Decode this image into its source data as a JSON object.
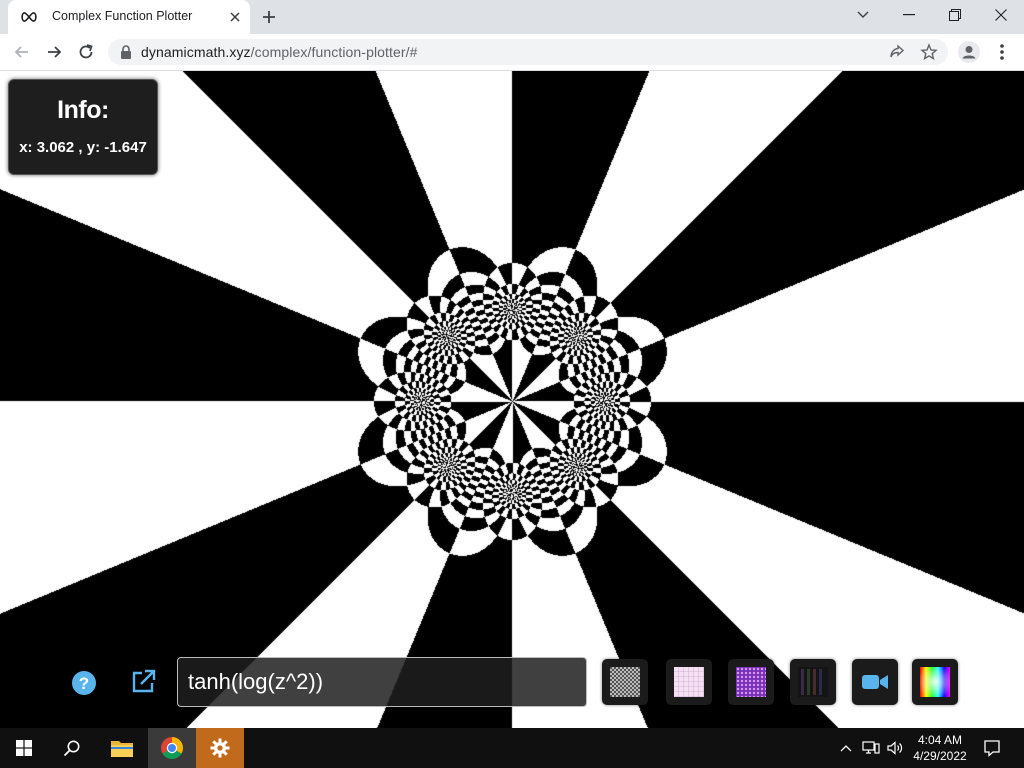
{
  "browser": {
    "tab_title": "Complex Function Plotter",
    "url_domain": "dynamicmath.xyz",
    "url_path": "/complex/function-plotter/#"
  },
  "info_panel": {
    "title": "Info:",
    "coords": "x: 3.062 , y: -1.647"
  },
  "function_input": {
    "value": "tanh(log(z^2))"
  },
  "tools": {
    "help_icon": "question-circle-icon",
    "external_icon": "external-link-icon",
    "camera_icon": "video-camera-icon",
    "color_icon": "color-wheel-icon",
    "tiles": [
      {
        "name": "checkerboard-texture-button",
        "color": "#8a8a8a"
      },
      {
        "name": "grid-texture-button",
        "color": "#e8c8e8"
      },
      {
        "name": "purple-texture-button",
        "color": "#9b4fcf"
      },
      {
        "name": "dark-stripes-texture-button",
        "color": "#2a2a2a"
      }
    ]
  },
  "taskbar": {
    "time": "4:04 AM",
    "date": "4/29/2022"
  },
  "colors": {
    "accent_blue": "#5ab4ec",
    "settings_orange": "#c26a1c"
  }
}
